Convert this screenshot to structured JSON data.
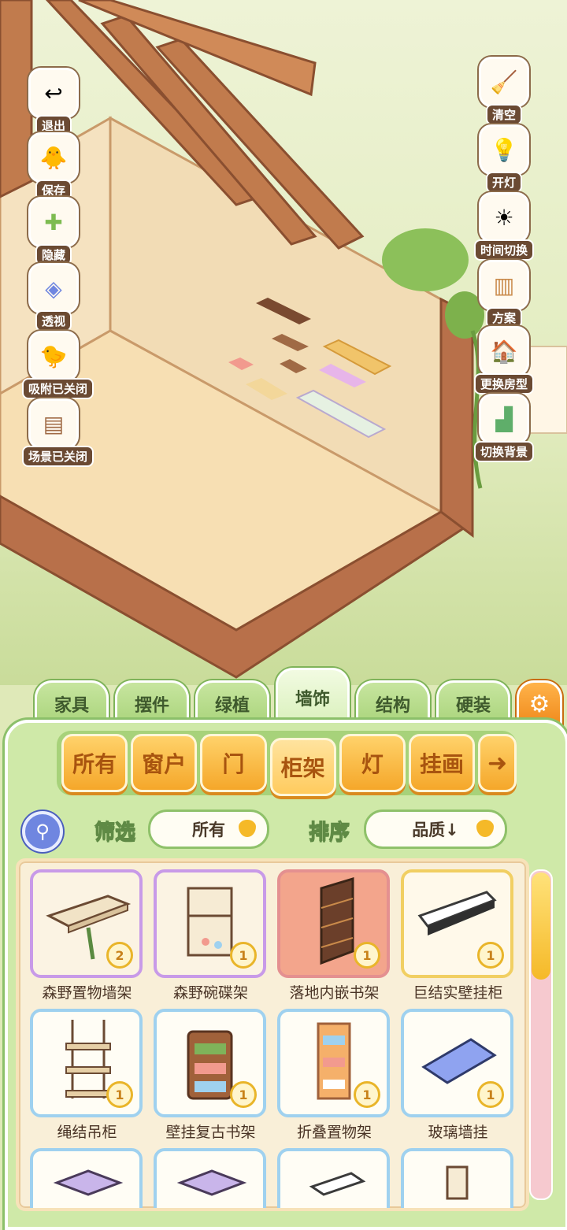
{
  "left_buttons": [
    {
      "label": "退出",
      "icon": "exit-icon"
    },
    {
      "label": "保存",
      "icon": "save-icon"
    },
    {
      "label": "隐藏",
      "icon": "hide-icon"
    },
    {
      "label": "透视",
      "icon": "perspective-icon"
    },
    {
      "label": "吸附已关闭",
      "icon": "snap-icon"
    },
    {
      "label": "场景已关闭",
      "icon": "scene-icon"
    }
  ],
  "right_buttons": [
    {
      "label": "清空",
      "icon": "clear-icon"
    },
    {
      "label": "开灯",
      "icon": "light-icon"
    },
    {
      "label": "时间切换",
      "icon": "time-icon"
    },
    {
      "label": "方案",
      "icon": "plan-icon"
    },
    {
      "label": "更换房型",
      "icon": "house-icon"
    },
    {
      "label": "切换背景",
      "icon": "background-icon"
    }
  ],
  "category_tabs": [
    "家具",
    "摆件",
    "绿植",
    "墙饰",
    "结构",
    "硬装"
  ],
  "active_category": "墙饰",
  "sub_tabs": [
    "所有",
    "窗户",
    "门",
    "柜架",
    "灯",
    "挂画"
  ],
  "active_sub_tab": "柜架",
  "filter": {
    "label": "筛选",
    "value": "所有"
  },
  "sort": {
    "label": "排序",
    "value": "品质↓"
  },
  "items": [
    {
      "name": "森野置物墙架",
      "count": "2",
      "frame": "purple"
    },
    {
      "name": "森野碗碟架",
      "count": "1",
      "frame": "purple"
    },
    {
      "name": "落地内嵌书架",
      "count": "1",
      "frame": "red"
    },
    {
      "name": "巨结实壁挂柜",
      "count": "1",
      "frame": "gold"
    },
    {
      "name": "绳结吊柜",
      "count": "1",
      "frame": "blue"
    },
    {
      "name": "壁挂复古书架",
      "count": "1",
      "frame": "blue"
    },
    {
      "name": "折叠置物架",
      "count": "1",
      "frame": "blue"
    },
    {
      "name": "玻璃墙挂",
      "count": "1",
      "frame": "blue"
    },
    {
      "name": "",
      "count": "",
      "frame": "blue"
    },
    {
      "name": "",
      "count": "",
      "frame": "blue"
    },
    {
      "name": "",
      "count": "",
      "frame": "blue"
    },
    {
      "name": "",
      "count": "",
      "frame": "blue"
    }
  ],
  "colors": {
    "panel": "#cfe9a8",
    "tab": "#a9d47b",
    "subtab": "#f5a72a",
    "scene_floor": "#f6dfb6"
  }
}
